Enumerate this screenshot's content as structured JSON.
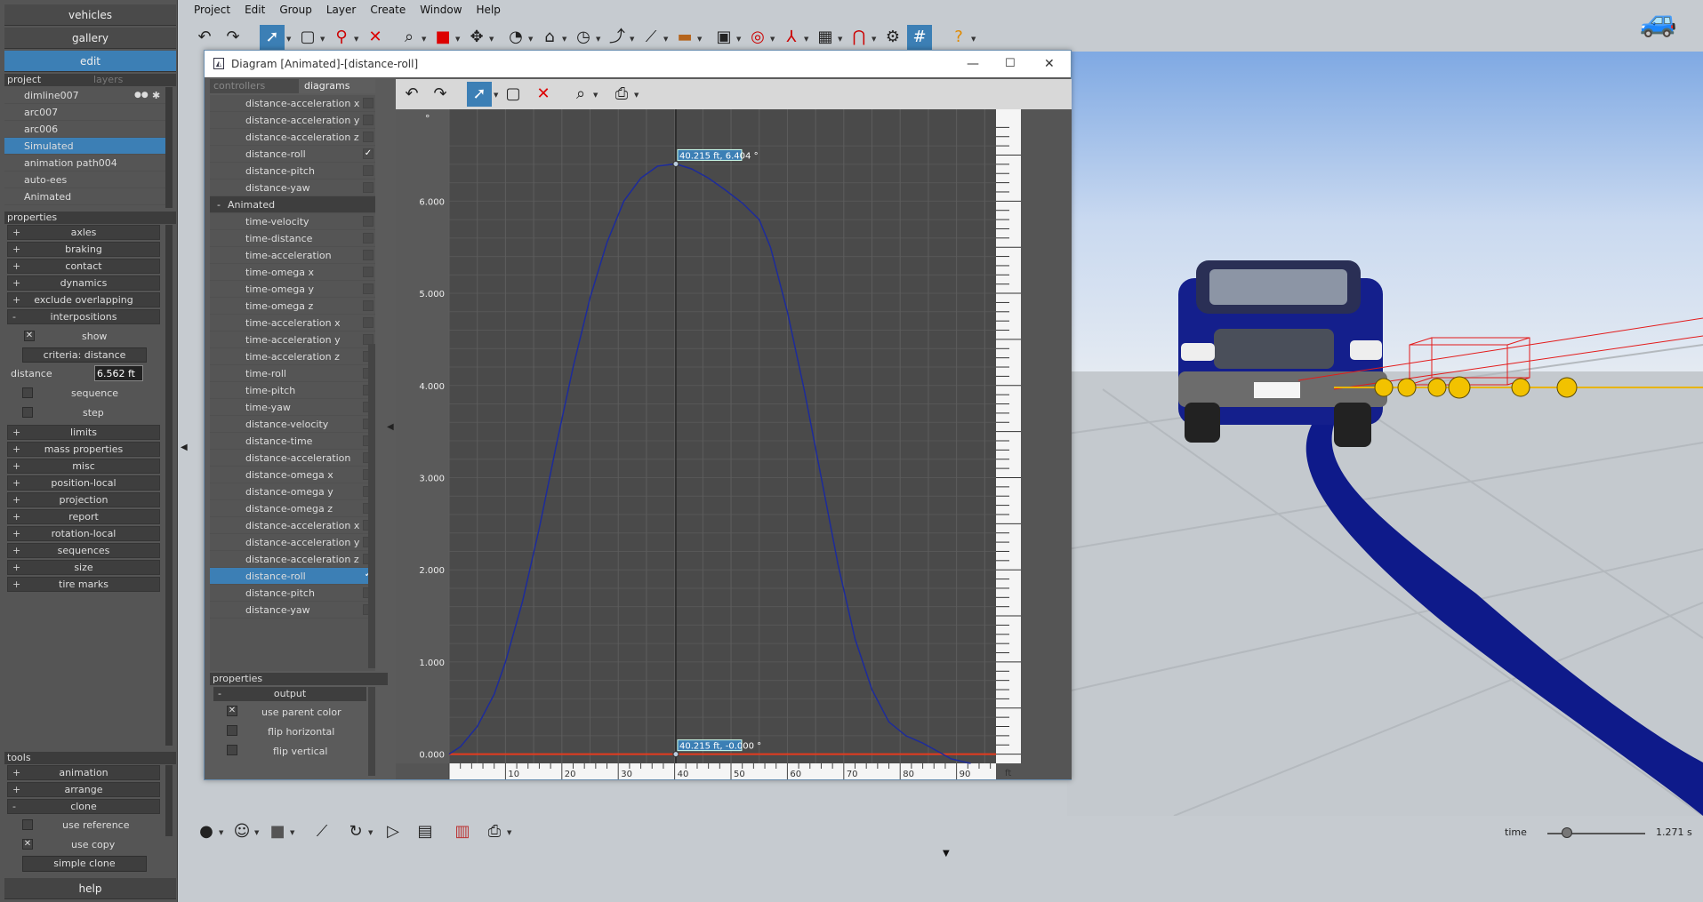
{
  "left_panel": {
    "top_buttons": [
      "vehicles",
      "gallery",
      "edit"
    ],
    "tabs": {
      "project": "project",
      "layers": "layers"
    },
    "project_items": [
      "dimline007",
      "arc007",
      "arc006",
      "Simulated",
      "animation path004",
      "auto-ees",
      "Animated"
    ],
    "properties_header": "properties",
    "properties": [
      {
        "sign": "+",
        "label": "axles"
      },
      {
        "sign": "+",
        "label": "braking"
      },
      {
        "sign": "+",
        "label": "contact"
      },
      {
        "sign": "+",
        "label": "dynamics"
      },
      {
        "sign": "+",
        "label": "exclude overlapping"
      },
      {
        "sign": "-",
        "label": "interpositions"
      }
    ],
    "show_label": "show",
    "criteria_label": "criteria: distance",
    "distance_label": "distance",
    "distance_value": "6.562 ft",
    "sequence_label": "sequence",
    "step_label": "step",
    "properties2": [
      {
        "sign": "+",
        "label": "limits"
      },
      {
        "sign": "+",
        "label": "mass properties"
      },
      {
        "sign": "+",
        "label": "misc"
      },
      {
        "sign": "+",
        "label": "position-local"
      },
      {
        "sign": "+",
        "label": "projection"
      },
      {
        "sign": "+",
        "label": "report"
      },
      {
        "sign": "+",
        "label": "rotation-local"
      },
      {
        "sign": "+",
        "label": "sequences"
      },
      {
        "sign": "+",
        "label": "size"
      },
      {
        "sign": "+",
        "label": "tire marks"
      }
    ],
    "tools_header": "tools",
    "tools": [
      {
        "sign": "+",
        "label": "animation"
      },
      {
        "sign": "+",
        "label": "arrange"
      },
      {
        "sign": "-",
        "label": "clone"
      }
    ],
    "use_reference_label": "use reference",
    "use_copy_label": "use copy",
    "simple_clone_label": "simple clone",
    "help_label": "help"
  },
  "menu": [
    "Project",
    "Edit",
    "Group",
    "Layer",
    "Create",
    "Window",
    "Help"
  ],
  "diagram_window": {
    "title": "Diagram [Animated]-[distance-roll]",
    "tabs": {
      "controllers": "controllers",
      "diagrams": "diagrams"
    },
    "tree_top": [
      "distance-acceleration x",
      "distance-acceleration y",
      "distance-acceleration z",
      "distance-roll",
      "distance-pitch",
      "distance-yaw"
    ],
    "group_label": "Animated",
    "group_sign": "-",
    "tree_group": [
      "time-velocity",
      "time-distance",
      "time-acceleration",
      "time-omega x",
      "time-omega y",
      "time-omega z",
      "time-acceleration x",
      "time-acceleration y",
      "time-acceleration z",
      "time-roll",
      "time-pitch",
      "time-yaw",
      "distance-velocity",
      "distance-time",
      "distance-acceleration",
      "distance-omega x",
      "distance-omega y",
      "distance-omega z",
      "distance-acceleration x",
      "distance-acceleration y",
      "distance-acceleration z",
      "distance-roll",
      "distance-pitch",
      "distance-yaw"
    ],
    "checked_top": "distance-roll",
    "selected_item": "distance-roll",
    "props_header": "properties",
    "output_label": "output",
    "use_parent_color_label": "use parent color",
    "flip_horizontal_label": "flip horizontal",
    "flip_vertical_label": "flip vertical"
  },
  "chart_data": {
    "type": "line",
    "title": "",
    "xlabel": "",
    "ylabel": "",
    "y_unit": "°",
    "x_unit": "ft",
    "xlim": [
      0,
      97
    ],
    "ylim": [
      -0.1,
      6.9
    ],
    "x_ticks": [
      10,
      20,
      30,
      40,
      50,
      60,
      70,
      80,
      90
    ],
    "y_ticks": [
      "0.000",
      "1.000",
      "2.000",
      "3.000",
      "4.000",
      "5.000",
      "6.000"
    ],
    "y_tick_values": [
      0,
      1,
      2,
      3,
      4,
      5,
      6
    ],
    "series": [
      {
        "color": "#1d2b9a",
        "x": [
          0,
          2,
          5,
          8,
          10,
          13,
          16,
          19,
          22,
          25,
          28,
          31,
          34,
          37,
          40.2,
          43,
          46,
          49,
          52,
          55,
          57,
          60,
          63,
          66,
          69,
          72,
          75,
          78,
          81,
          84,
          87,
          89,
          91,
          92.5
        ],
        "y": [
          0.0,
          0.08,
          0.3,
          0.65,
          1.0,
          1.65,
          2.45,
          3.35,
          4.2,
          4.95,
          5.55,
          6.0,
          6.25,
          6.38,
          6.404,
          6.35,
          6.25,
          6.12,
          5.98,
          5.8,
          5.5,
          4.8,
          3.95,
          3.0,
          2.05,
          1.25,
          0.7,
          0.35,
          0.2,
          0.12,
          0.02,
          -0.05,
          -0.08,
          -0.1
        ]
      }
    ],
    "cursor_x": 40.215,
    "markers": [
      {
        "x": 40.215,
        "y": 6.404,
        "label": "40.215 ft, 6.404 °"
      },
      {
        "x": 40.215,
        "y": 0.0,
        "label": "40.215 ft, -0.000 °"
      }
    ],
    "baseline_color": "#e63b1d",
    "grid": true
  },
  "bottom_bar": {
    "time_label": "time",
    "time_value": "1.271 s",
    "time_slider_fraction": 0.2
  },
  "colors": {
    "accent": "#3c7fb5",
    "panel": "#555555",
    "curve": "#1d2b9a",
    "baseline": "#e63b1d"
  }
}
